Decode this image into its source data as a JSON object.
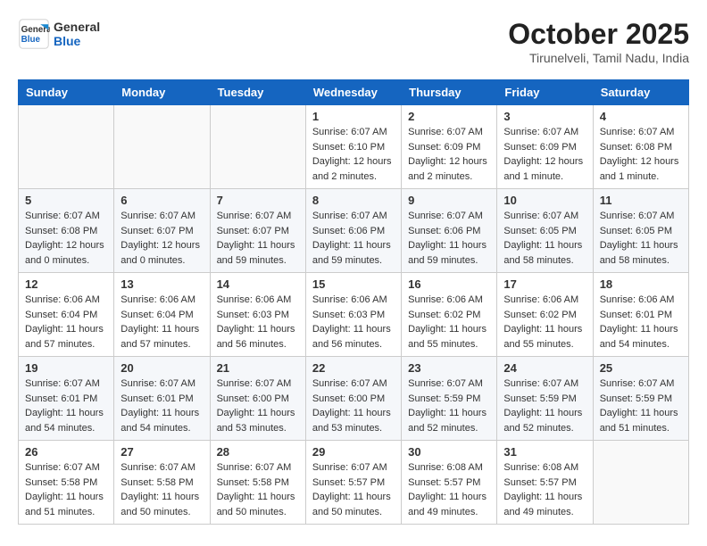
{
  "header": {
    "logo_line1": "General",
    "logo_line2": "Blue",
    "month": "October 2025",
    "location": "Tirunelveli, Tamil Nadu, India"
  },
  "weekdays": [
    "Sunday",
    "Monday",
    "Tuesday",
    "Wednesday",
    "Thursday",
    "Friday",
    "Saturday"
  ],
  "weeks": [
    [
      {
        "day": "",
        "info": ""
      },
      {
        "day": "",
        "info": ""
      },
      {
        "day": "",
        "info": ""
      },
      {
        "day": "1",
        "info": "Sunrise: 6:07 AM\nSunset: 6:10 PM\nDaylight: 12 hours\nand 2 minutes."
      },
      {
        "day": "2",
        "info": "Sunrise: 6:07 AM\nSunset: 6:09 PM\nDaylight: 12 hours\nand 2 minutes."
      },
      {
        "day": "3",
        "info": "Sunrise: 6:07 AM\nSunset: 6:09 PM\nDaylight: 12 hours\nand 1 minute."
      },
      {
        "day": "4",
        "info": "Sunrise: 6:07 AM\nSunset: 6:08 PM\nDaylight: 12 hours\nand 1 minute."
      }
    ],
    [
      {
        "day": "5",
        "info": "Sunrise: 6:07 AM\nSunset: 6:08 PM\nDaylight: 12 hours\nand 0 minutes."
      },
      {
        "day": "6",
        "info": "Sunrise: 6:07 AM\nSunset: 6:07 PM\nDaylight: 12 hours\nand 0 minutes."
      },
      {
        "day": "7",
        "info": "Sunrise: 6:07 AM\nSunset: 6:07 PM\nDaylight: 11 hours\nand 59 minutes."
      },
      {
        "day": "8",
        "info": "Sunrise: 6:07 AM\nSunset: 6:06 PM\nDaylight: 11 hours\nand 59 minutes."
      },
      {
        "day": "9",
        "info": "Sunrise: 6:07 AM\nSunset: 6:06 PM\nDaylight: 11 hours\nand 59 minutes."
      },
      {
        "day": "10",
        "info": "Sunrise: 6:07 AM\nSunset: 6:05 PM\nDaylight: 11 hours\nand 58 minutes."
      },
      {
        "day": "11",
        "info": "Sunrise: 6:07 AM\nSunset: 6:05 PM\nDaylight: 11 hours\nand 58 minutes."
      }
    ],
    [
      {
        "day": "12",
        "info": "Sunrise: 6:06 AM\nSunset: 6:04 PM\nDaylight: 11 hours\nand 57 minutes."
      },
      {
        "day": "13",
        "info": "Sunrise: 6:06 AM\nSunset: 6:04 PM\nDaylight: 11 hours\nand 57 minutes."
      },
      {
        "day": "14",
        "info": "Sunrise: 6:06 AM\nSunset: 6:03 PM\nDaylight: 11 hours\nand 56 minutes."
      },
      {
        "day": "15",
        "info": "Sunrise: 6:06 AM\nSunset: 6:03 PM\nDaylight: 11 hours\nand 56 minutes."
      },
      {
        "day": "16",
        "info": "Sunrise: 6:06 AM\nSunset: 6:02 PM\nDaylight: 11 hours\nand 55 minutes."
      },
      {
        "day": "17",
        "info": "Sunrise: 6:06 AM\nSunset: 6:02 PM\nDaylight: 11 hours\nand 55 minutes."
      },
      {
        "day": "18",
        "info": "Sunrise: 6:06 AM\nSunset: 6:01 PM\nDaylight: 11 hours\nand 54 minutes."
      }
    ],
    [
      {
        "day": "19",
        "info": "Sunrise: 6:07 AM\nSunset: 6:01 PM\nDaylight: 11 hours\nand 54 minutes."
      },
      {
        "day": "20",
        "info": "Sunrise: 6:07 AM\nSunset: 6:01 PM\nDaylight: 11 hours\nand 54 minutes."
      },
      {
        "day": "21",
        "info": "Sunrise: 6:07 AM\nSunset: 6:00 PM\nDaylight: 11 hours\nand 53 minutes."
      },
      {
        "day": "22",
        "info": "Sunrise: 6:07 AM\nSunset: 6:00 PM\nDaylight: 11 hours\nand 53 minutes."
      },
      {
        "day": "23",
        "info": "Sunrise: 6:07 AM\nSunset: 5:59 PM\nDaylight: 11 hours\nand 52 minutes."
      },
      {
        "day": "24",
        "info": "Sunrise: 6:07 AM\nSunset: 5:59 PM\nDaylight: 11 hours\nand 52 minutes."
      },
      {
        "day": "25",
        "info": "Sunrise: 6:07 AM\nSunset: 5:59 PM\nDaylight: 11 hours\nand 51 minutes."
      }
    ],
    [
      {
        "day": "26",
        "info": "Sunrise: 6:07 AM\nSunset: 5:58 PM\nDaylight: 11 hours\nand 51 minutes."
      },
      {
        "day": "27",
        "info": "Sunrise: 6:07 AM\nSunset: 5:58 PM\nDaylight: 11 hours\nand 50 minutes."
      },
      {
        "day": "28",
        "info": "Sunrise: 6:07 AM\nSunset: 5:58 PM\nDaylight: 11 hours\nand 50 minutes."
      },
      {
        "day": "29",
        "info": "Sunrise: 6:07 AM\nSunset: 5:57 PM\nDaylight: 11 hours\nand 50 minutes."
      },
      {
        "day": "30",
        "info": "Sunrise: 6:08 AM\nSunset: 5:57 PM\nDaylight: 11 hours\nand 49 minutes."
      },
      {
        "day": "31",
        "info": "Sunrise: 6:08 AM\nSunset: 5:57 PM\nDaylight: 11 hours\nand 49 minutes."
      },
      {
        "day": "",
        "info": ""
      }
    ]
  ]
}
